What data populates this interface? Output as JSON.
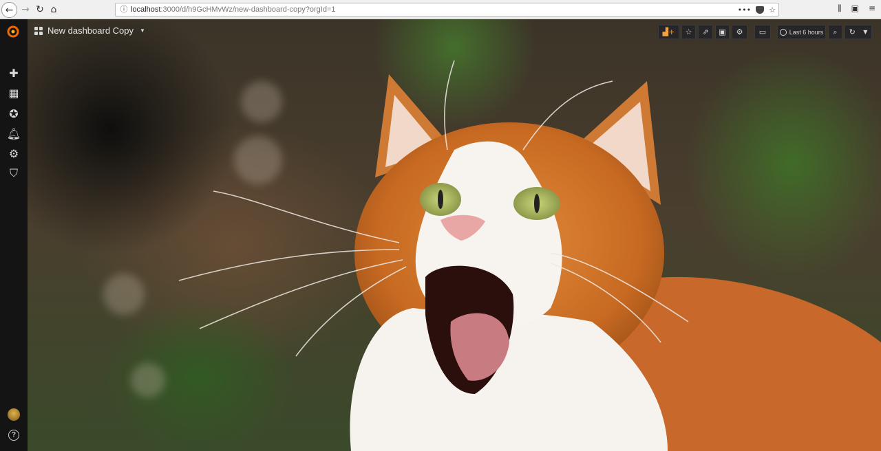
{
  "browser": {
    "url_host": "localhost",
    "url_path": ":3000/d/h9GcHMvWz/new-dashboard-copy?orgId=1",
    "icons": [
      "back-icon",
      "forward-icon",
      "reload-icon",
      "home-icon",
      "info-icon",
      "more-icon",
      "pocket-icon",
      "bookmark-star-icon",
      "library-icon",
      "sidebar-icon",
      "menu-icon"
    ]
  },
  "dashboard": {
    "title": "New dashboard Copy",
    "time_range": "Last 6 hours"
  },
  "toolbar": {
    "buttons": [
      "add-panel",
      "star",
      "share",
      "save",
      "settings",
      "view-mode",
      "time-picker",
      "zoom-out",
      "refresh",
      "refresh-interval"
    ]
  },
  "sidebar": {
    "items": [
      "create",
      "dashboards",
      "explore",
      "alerting",
      "configuration",
      "server-admin"
    ]
  },
  "colors": {
    "sidebar_bg": "#141414",
    "toolbar_btn_bg": "#262628",
    "grafana_orange": "#f46800"
  }
}
